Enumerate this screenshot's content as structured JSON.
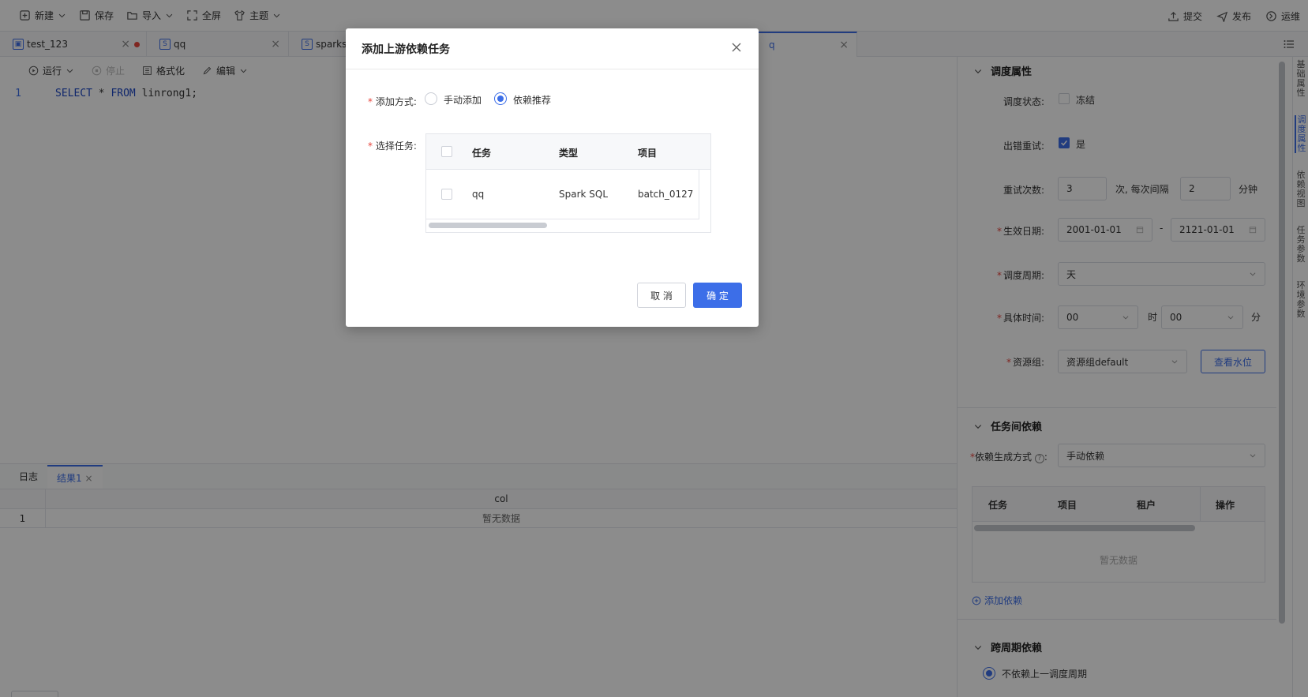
{
  "toolbar": {
    "new_label": "新建",
    "save_label": "保存",
    "import_label": "导入",
    "fullscreen_label": "全屏",
    "theme_label": "主题",
    "submit_label": "提交",
    "publish_label": "发布",
    "ops_label": "运维"
  },
  "tabs": [
    {
      "label": "test_123"
    },
    {
      "label": "qq"
    },
    {
      "label": "sparksq"
    },
    {
      "label": "q"
    }
  ],
  "editor": {
    "run_label": "运行",
    "stop_label": "停止",
    "format_label": "格式化",
    "edit_label": "编辑",
    "line_number": "1",
    "code_kw1": "SELECT",
    "code_mid": " * ",
    "code_kw2": "FROM",
    "code_rest": " linrong1;"
  },
  "bottom": {
    "log_tab": "日志",
    "result_tab": "结果1",
    "col_header": "col",
    "row_index": "1",
    "no_data": "暂无数据"
  },
  "schedule": {
    "title": "调度属性",
    "status_label": "调度状态:",
    "freeze_label": "冻结",
    "retry_label": "出错重试:",
    "retry_yes": "是",
    "retry_count_label": "重试次数:",
    "retry_count": "3",
    "retry_interval_text": "次, 每次间隔",
    "retry_interval": "2",
    "minute_unit": "分钟",
    "effective_label": "生效日期:",
    "start_date": "2001-01-01",
    "date_sep": "-",
    "end_date": "2121-01-01",
    "period_label": "调度周期:",
    "period_value": "天",
    "time_label": "具体时间:",
    "hour_value": "00",
    "hour_unit": "时",
    "minute_value": "00",
    "minute_short": "分",
    "resource_label": "资源组:",
    "resource_value": "资源组default",
    "watermark_button": "查看水位"
  },
  "dependency": {
    "title": "任务间依赖",
    "gen_label": "依赖生成方式",
    "gen_value": "手动依赖",
    "columns": [
      "任务",
      "项目",
      "租户",
      "操作"
    ],
    "no_data": "暂无数据",
    "add_label": "添加依赖"
  },
  "cross": {
    "title": "跨周期依赖",
    "option1": "不依赖上一调度周期"
  },
  "side_tabs": [
    "基础属性",
    "调度属性",
    "依赖视图",
    "任务参数",
    "环境参数"
  ],
  "modal": {
    "title": "添加上游依赖任务",
    "method_label": "添加方式:",
    "manual_option": "手动添加",
    "recommend_option": "依赖推荐",
    "select_label": "选择任务:",
    "columns": [
      "任务",
      "类型",
      "项目"
    ],
    "rows": [
      {
        "task": "qq",
        "type": "Spark SQL",
        "project": "batch_0127"
      }
    ],
    "cancel_label": "取 消",
    "ok_label": "确 定"
  },
  "colors": {
    "accent": "#3c6ee8",
    "required": "#e8453c"
  }
}
